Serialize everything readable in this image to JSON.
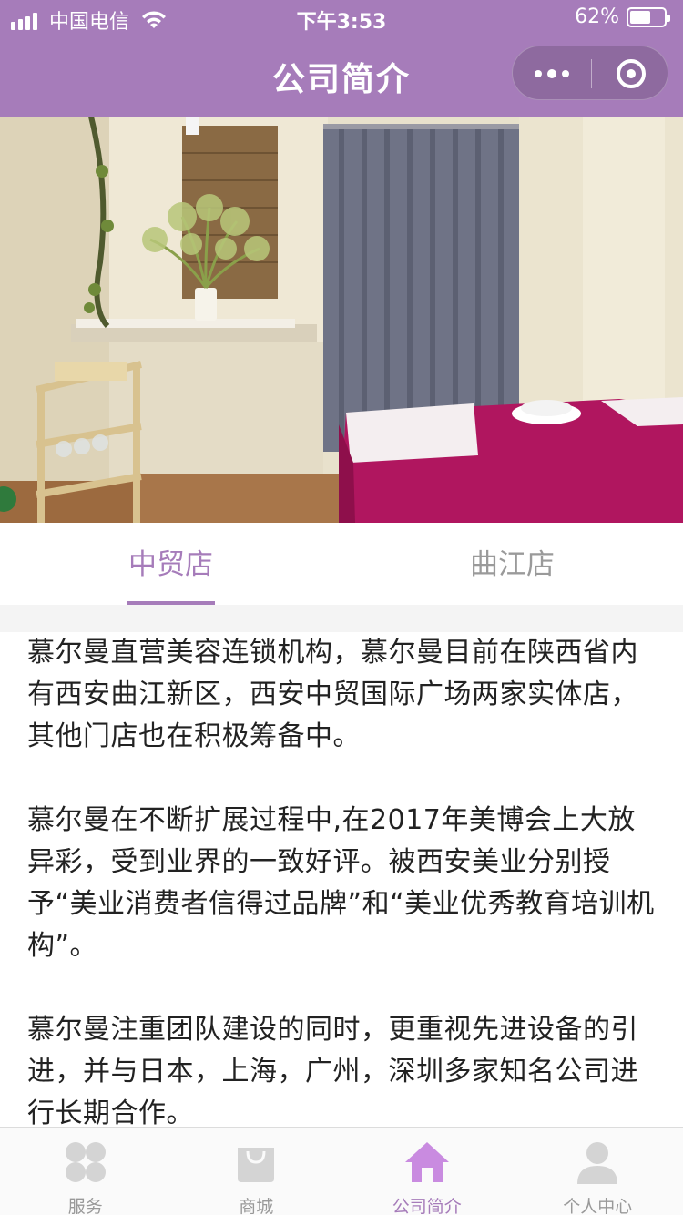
{
  "status_bar": {
    "carrier": "中国电信",
    "time": "下午3:53",
    "battery_percent_text": "62%",
    "battery_level": 0.62
  },
  "nav": {
    "title": "公司简介"
  },
  "store_tabs": [
    {
      "label": "中贸店",
      "active": true
    },
    {
      "label": "曲江店",
      "active": false
    }
  ],
  "intro": {
    "paragraphs": [
      "慕尔曼直营美容连锁机构，慕尔曼目前在陕西省内有西安曲江新区，西安中贸国际广场两家实体店，其他门店也在积极筹备中。",
      "慕尔曼在不断扩展过程中,在2017年美博会上大放异彩，受到业界的一致好评。被西安美业分别授予“美业消费者信得过品牌”和“美业优秀教育培训机构”。",
      "慕尔曼注重团队建设的同时，更重视先进设备的引进，并与日本，上海，广州，深圳多家知名公司进行长期合作。"
    ]
  },
  "tabbar": {
    "items": [
      {
        "label": "服务",
        "icon": "grid-flower-icon",
        "active": false
      },
      {
        "label": "商城",
        "icon": "shopping-bag-icon",
        "active": false
      },
      {
        "label": "公司简介",
        "icon": "home-icon",
        "active": true
      },
      {
        "label": "个人中心",
        "icon": "user-icon",
        "active": false
      }
    ]
  },
  "colors": {
    "accent": "#a67cba",
    "inactive": "#999999",
    "icon_inactive": "#d4d4d4"
  }
}
